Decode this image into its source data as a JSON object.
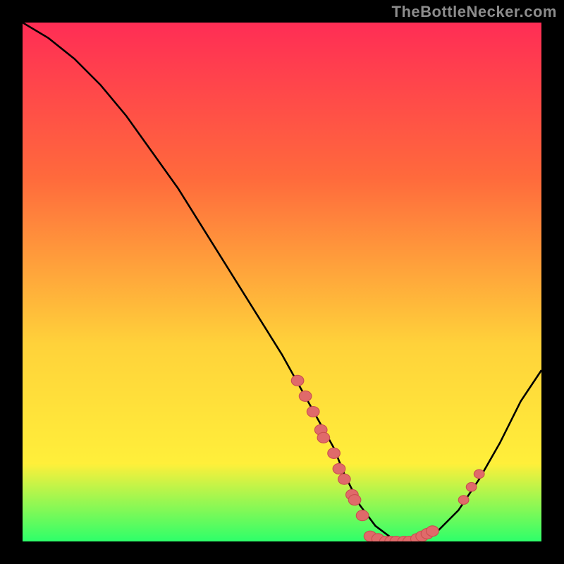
{
  "watermark": "TheBottleNecker.com",
  "colors": {
    "background": "#000000",
    "gradient_top": "#ff2d55",
    "gradient_mid1": "#ff6a3c",
    "gradient_mid2": "#ffd23a",
    "gradient_mid3": "#ffef3a",
    "gradient_bottom": "#2dff6a",
    "curve": "#000000",
    "marker_fill": "#e06a6a",
    "marker_stroke": "#c94f4f"
  },
  "chart_data": {
    "type": "line",
    "title": "",
    "xlabel": "",
    "ylabel": "",
    "xlim": [
      0,
      100
    ],
    "ylim": [
      0,
      100
    ],
    "curve": {
      "x": [
        0,
        5,
        10,
        15,
        20,
        25,
        30,
        35,
        40,
        45,
        50,
        55,
        60,
        62,
        65,
        68,
        72,
        76,
        80,
        84,
        88,
        92,
        96,
        100
      ],
      "y": [
        100,
        97,
        93,
        88,
        82,
        75,
        68,
        60,
        52,
        44,
        36,
        27,
        18,
        13,
        7,
        3,
        0,
        0,
        2,
        6,
        12,
        19,
        27,
        33
      ]
    },
    "series": [
      {
        "name": "descending-cluster",
        "type": "scatter",
        "x": [
          53,
          54.5,
          56,
          57.5,
          58,
          60,
          61,
          62,
          63.5,
          64,
          65.5
        ],
        "y": [
          31,
          28,
          25,
          21.5,
          20,
          17,
          14,
          12,
          9,
          8,
          5
        ]
      },
      {
        "name": "bottom-cluster",
        "type": "scatter",
        "x": [
          67,
          68.5,
          70,
          71,
          72,
          73.5,
          74.5,
          76,
          77,
          78,
          79
        ],
        "y": [
          1,
          0.5,
          0,
          0,
          0,
          0,
          0,
          0.5,
          1,
          1.5,
          2
        ]
      },
      {
        "name": "ascending-cluster",
        "type": "scatter",
        "x": [
          85,
          86.5,
          88
        ],
        "y": [
          8,
          10.5,
          13
        ]
      }
    ],
    "marker_radius": 1.2,
    "marker_radius_small": 1.0
  }
}
